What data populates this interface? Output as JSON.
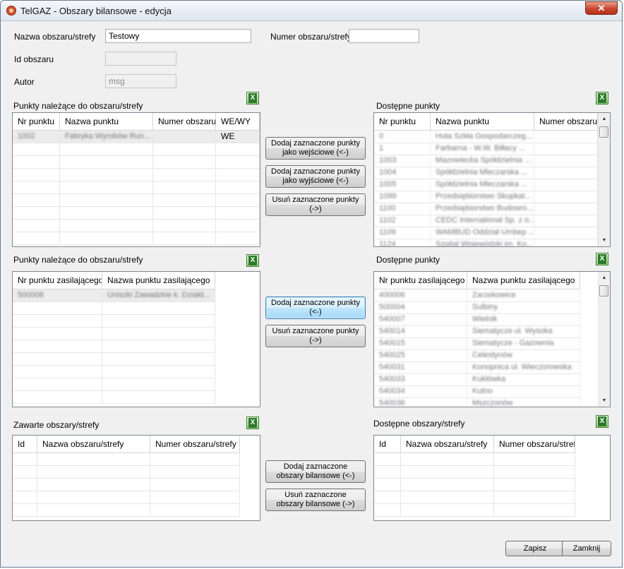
{
  "window": {
    "title": "TelGAZ - Obszary bilansowe - edycja",
    "close": "✕"
  },
  "form": {
    "name_label": "Nazwa obszaru/strefy",
    "name_value": "Testowy",
    "number_label": "Numer obszaru/strefy",
    "number_value": "",
    "id_label": "Id obszaru",
    "id_value": "",
    "author_label": "Autor",
    "author_value": "msg"
  },
  "points_left": {
    "title": "Punkty należące do obszaru/strefy",
    "columns": [
      "Nr punktu",
      "Nazwa punktu",
      "Numer obszaru",
      "WE/WY"
    ],
    "rows": [
      [
        "1002",
        "Fabryka Wyrobów Run...",
        "",
        "WE"
      ]
    ]
  },
  "points_right": {
    "title": "Dostępne punkty",
    "columns": [
      "Nr punktu",
      "Nazwa punktu",
      "Numer obszaru"
    ],
    "rows": [
      [
        "0",
        "Huta Szkła Gospodarczeg...",
        ""
      ],
      [
        "1",
        "Farbarna - W.W. Biłłacy ...",
        ""
      ],
      [
        "1003",
        "Mazowiecka Spółdzielnia ...",
        ""
      ],
      [
        "1004",
        "Spółdzielnia Mleczarska ...",
        ""
      ],
      [
        "1005",
        "Spółdzielnia Mleczarska ...",
        ""
      ],
      [
        "1099",
        "Przedsiębiorstwo Skupkat...",
        ""
      ],
      [
        "1100",
        "Przedsiębiorstwo Budowni...",
        ""
      ],
      [
        "1102",
        "CEDC International Sp. z o...",
        ""
      ],
      [
        "1109",
        "WAMBUD Oddział Umbep ...",
        ""
      ],
      [
        "1124",
        "Szpital Wojewódzki im. Ko...",
        ""
      ]
    ]
  },
  "buttons_points": {
    "add_in": "Dodaj zaznaczone punkty jako wejściowe (<-)",
    "add_out": "Dodaj zaznaczone punkty jako wyjściowe (<-)",
    "remove": "Usuń zaznaczone punkty (->)"
  },
  "supply_left": {
    "title": "Punkty należące do obszaru/strefy",
    "columns": [
      "Nr punktu zasilającego",
      "Nazwa punktu zasilającego"
    ],
    "rows": [
      [
        "500008",
        "Uniszki Zawadzkie k. Działd..."
      ]
    ]
  },
  "supply_right": {
    "title": "Dostępne punkty",
    "columns": [
      "Nr punktu zasilającego",
      "Nazwa punktu zasilającego"
    ],
    "rows": [
      [
        "400006",
        "Zarzekowice"
      ],
      [
        "500004",
        "Sulbiny"
      ],
      [
        "540007",
        "Wielnik"
      ],
      [
        "540014",
        "Siematycze ul. Wysoka"
      ],
      [
        "540015",
        "Siematycze - Gazownia"
      ],
      [
        "540025",
        "Celestynów"
      ],
      [
        "540031",
        "Konopnica ul. Wieczorowska"
      ],
      [
        "540033",
        "Kuklówka"
      ],
      [
        "540034",
        "Kutno"
      ],
      [
        "540036",
        "Mszczonów"
      ]
    ]
  },
  "buttons_supply": {
    "add": "Dodaj zaznaczone punkty (<-)",
    "remove": "Usuń zaznaczone punkty (->)"
  },
  "areas_left": {
    "title": "Zawarte obszary/strefy",
    "columns": [
      "Id",
      "Nazwa obszaru/strefy",
      "Numer obszaru/strefy"
    ]
  },
  "areas_right": {
    "title": "Dostępne obszary/strefy",
    "columns": [
      "Id",
      "Nazwa obszaru/strefy",
      "Numer obszaru/strefy"
    ]
  },
  "buttons_areas": {
    "add": "Dodaj zaznaczone obszary bilansowe (<-)",
    "remove": "Usuń zaznaczone obszary bilansowe (->)"
  },
  "footer": {
    "save": "Zapisz",
    "close": "Zamknij"
  },
  "icons": {
    "excel": "excel-export-icon",
    "excel_letter": "X"
  },
  "colors": {
    "accent": "#3c7fb1",
    "excel_green": "#2c7a28",
    "close_red": "#c8472c"
  }
}
